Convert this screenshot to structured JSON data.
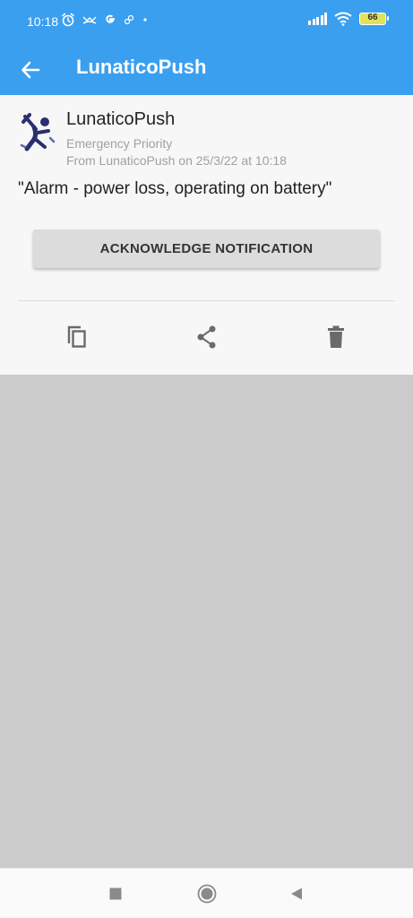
{
  "status_bar": {
    "time": "10:18",
    "battery": "66",
    "notification_icons": [
      "alarm-icon",
      "missed-call-icon",
      "google-icon",
      "link-icon",
      "dot-icon"
    ],
    "system_icons": [
      "signal-icon",
      "wifi-icon",
      "battery-icon"
    ]
  },
  "app_bar": {
    "title": "LunaticoPush",
    "back_icon": "arrow-left-icon"
  },
  "notification": {
    "app_name": "LunaticoPush",
    "priority": "Emergency Priority",
    "from": "From LunaticoPush on 25/3/22 at 10:18",
    "message": "\"Alarm - power loss, operating on battery\"",
    "ack_label": "ACKNOWLEDGE NOTIFICATION"
  },
  "actions": [
    {
      "icon": "copy-icon"
    },
    {
      "icon": "share-icon"
    },
    {
      "icon": "delete-icon"
    }
  ],
  "nav_bar": {
    "icons": [
      "recents-icon",
      "home-icon",
      "back-icon"
    ]
  },
  "colors": {
    "primary": "#3b9ff0",
    "card_background": "#f7f7f7",
    "empty_area": "#cbcbcb",
    "button": "#dcdcdc"
  }
}
